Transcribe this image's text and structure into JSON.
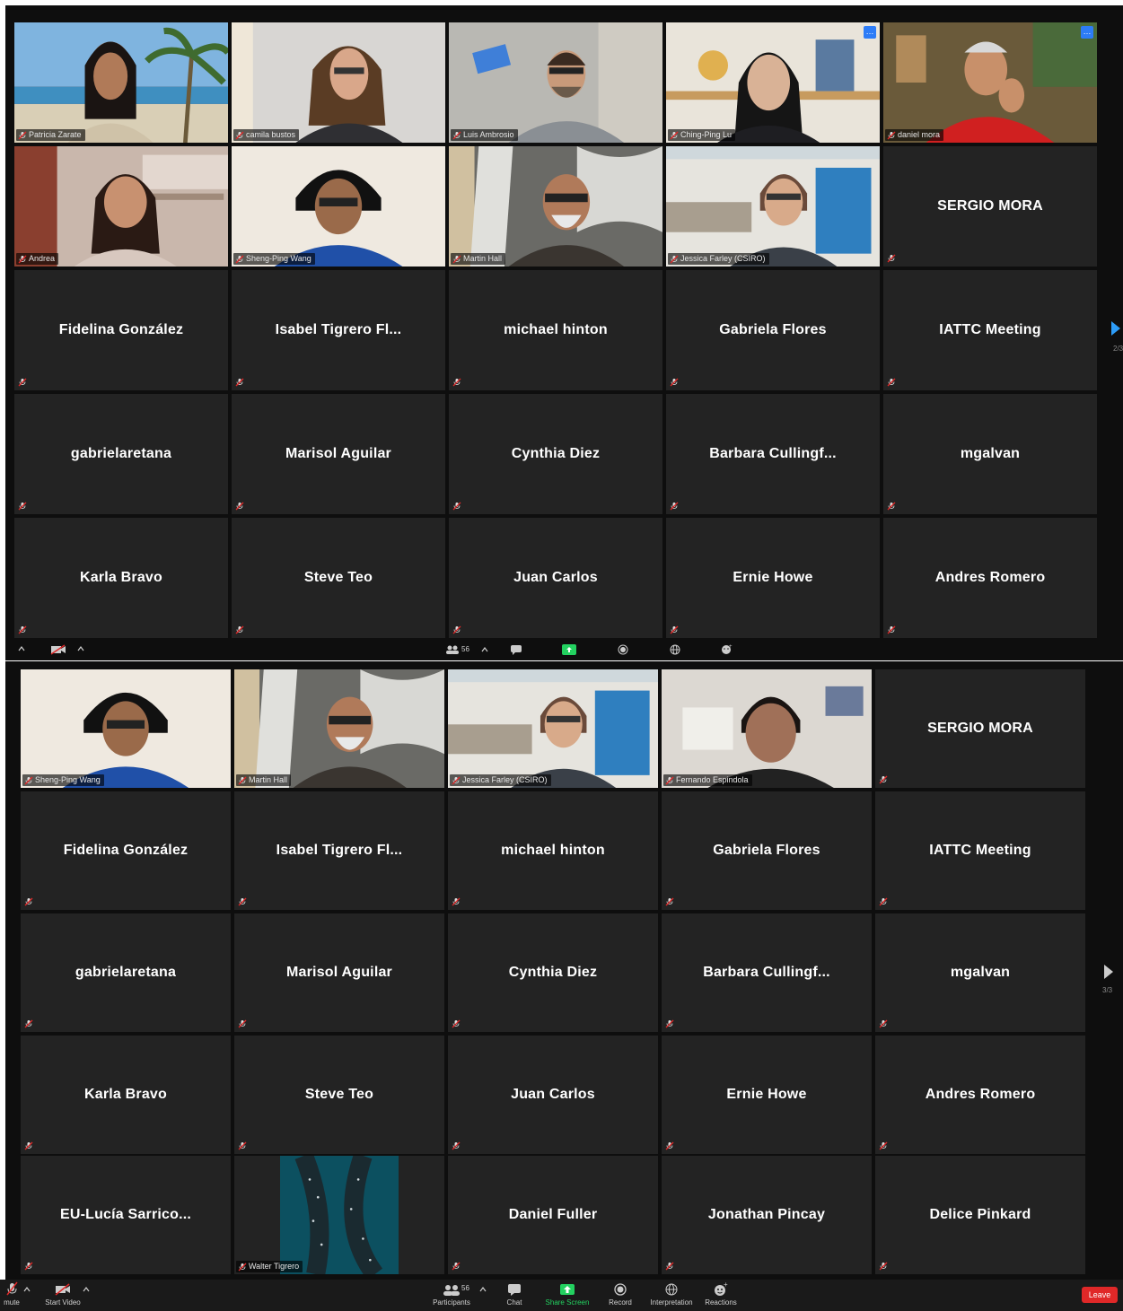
{
  "top_panel": {
    "video_tiles": [
      {
        "name": "Patricia Zarate",
        "scene": "beach"
      },
      {
        "name": "camila bustos",
        "scene": "room_light"
      },
      {
        "name": "Luis Ambrosio",
        "scene": "room_grey"
      },
      {
        "name": "Ching-Ping Lu",
        "scene": "room_shelf",
        "more": true
      },
      {
        "name": "daniel mora",
        "scene": "room_red",
        "more": true
      },
      {
        "name": "Andrea",
        "scene": "kitchen"
      },
      {
        "name": "Sheng-Ping Wang",
        "scene": "dark_blue"
      },
      {
        "name": "Martin Hall",
        "scene": "trees"
      },
      {
        "name": "Jessica Farley (CSIRO)",
        "scene": "office"
      }
    ],
    "name_tiles": [
      "SERGIO MORA",
      "Fidelina González",
      "Isabel Tigrero Fl...",
      "michael hinton",
      "Gabriela Flores",
      "IATTC Meeting",
      "gabrielaretana",
      "Marisol Aguilar",
      "Cynthia Diez",
      "Barbara Cullingf...",
      "mgalvan",
      "Karla Bravo",
      "Steve Teo",
      "Juan Carlos",
      "Ernie Howe",
      "Andres Romero"
    ],
    "page_indicator": "2/3"
  },
  "middle_toolbar": {
    "participant_count": "56"
  },
  "bottom_panel": {
    "video_tiles": [
      {
        "name": "Sheng-Ping Wang",
        "scene": "dark_blue"
      },
      {
        "name": "Martin Hall",
        "scene": "trees"
      },
      {
        "name": "Jessica Farley (CSIRO)",
        "scene": "office"
      },
      {
        "name": "Fernando Espindola",
        "scene": "room_plain"
      }
    ],
    "name_tiles": [
      "SERGIO MORA",
      "Fidelina González",
      "Isabel Tigrero Fl...",
      "michael hinton",
      "Gabriela Flores",
      "IATTC Meeting",
      "gabrielaretana",
      "Marisol Aguilar",
      "Cynthia Diez",
      "Barbara Cullingf...",
      "mgalvan",
      "Karla Bravo",
      "Steve Teo",
      "Juan Carlos",
      "Ernie Howe",
      "Andres Romero",
      "EU-Lucía  Sarrico..."
    ],
    "walter_tile": {
      "name": "Walter Tigrero"
    },
    "name_tiles_last": [
      "Daniel Fuller",
      "Jonathan Pincay",
      "Delice Pinkard"
    ],
    "page_indicator": "3/3"
  },
  "bottom_toolbar": {
    "unmute_label": "mute",
    "start_video_label": "Start Video",
    "participants_label": "Participants",
    "participant_count": "56",
    "chat_label": "Chat",
    "share_label": "Share Screen",
    "record_label": "Record",
    "interpretation_label": "Interpretation",
    "reactions_label": "Reactions",
    "leave_label": "Leave"
  },
  "colors": {
    "accent_green": "#23d160",
    "leave_red": "#e02828",
    "tile_bg": "#232323",
    "more_blue": "#2d7cf7"
  }
}
